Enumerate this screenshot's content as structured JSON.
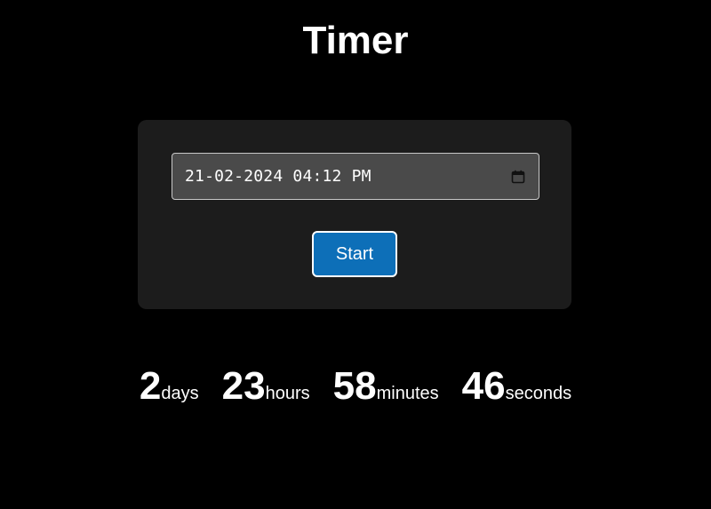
{
  "header": {
    "title": "Timer"
  },
  "form": {
    "datetime_value": "21-02-2024 04:12 PM",
    "start_label": "Start"
  },
  "countdown": {
    "days": {
      "value": "2",
      "label": "days"
    },
    "hours": {
      "value": "23",
      "label": "hours"
    },
    "minutes": {
      "value": "58",
      "label": "minutes"
    },
    "seconds": {
      "value": "46",
      "label": "seconds"
    }
  },
  "colors": {
    "background": "#000000",
    "card": "#1c1c1c",
    "input": "#4a4a4a",
    "button": "#0d6fb8",
    "text": "#ffffff"
  },
  "icons": {
    "calendar": "calendar-icon"
  }
}
